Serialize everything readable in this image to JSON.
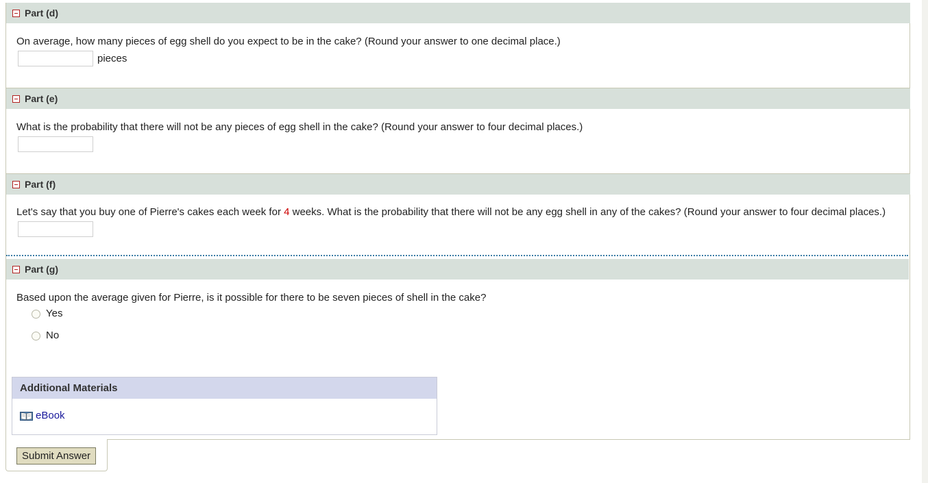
{
  "parts": [
    {
      "title": "Part (d)",
      "question": "On average, how many pieces of egg shell do you expect to be in the cake? (Round your answer to one decimal place.)",
      "input_value": "",
      "unit": "pieces"
    },
    {
      "title": "Part (e)",
      "question": "What is the probability that there will not be any pieces of egg shell in the cake? (Round your answer to four decimal places.)",
      "input_value": ""
    },
    {
      "title": "Part (f)",
      "question_before": "Let's say that you buy one of Pierre's cakes each week for ",
      "question_highlight": "4",
      "question_after": " weeks. What is the probability that there will not be any egg shell in any of the cakes? (Round your answer to four decimal places.)",
      "input_value": ""
    },
    {
      "title": "Part (g)",
      "question": "Based upon the average given for Pierre, is it possible for there to be seven pieces of shell in the cake?",
      "options": [
        "Yes",
        "No"
      ],
      "selected": null
    }
  ],
  "additional_materials": {
    "title": "Additional Materials",
    "links": [
      {
        "label": "eBook",
        "icon": "book-icon"
      }
    ]
  },
  "submit": {
    "label": "Submit Answer"
  },
  "colors": {
    "part_header_bg": "#d7e0da",
    "collapse_icon": "#b22222",
    "highlight_number": "#cc0000",
    "materials_header_bg": "#d3d7ec",
    "link": "#1a1a9c",
    "submit_bg": "#e0dcc0"
  }
}
